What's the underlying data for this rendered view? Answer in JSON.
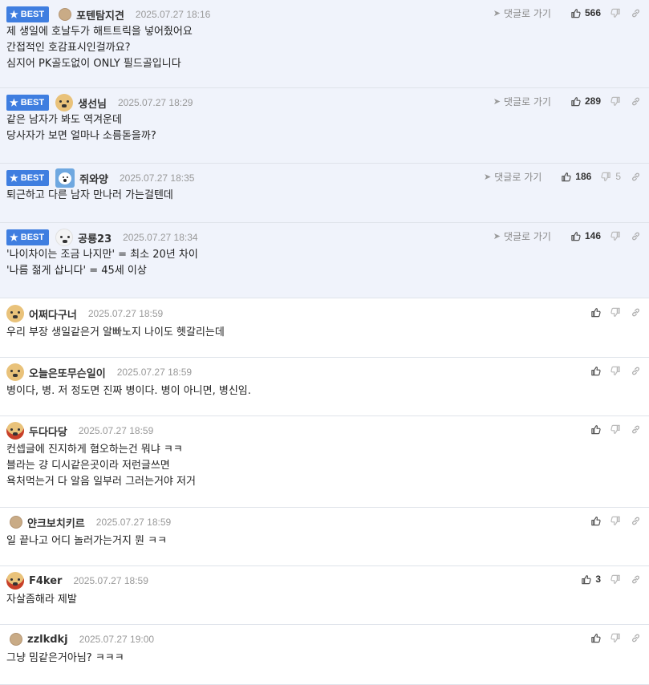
{
  "labels": {
    "best": "BEST",
    "reply": "댓글로 가기"
  },
  "colors": {
    "best_bg": "#f0f3fb",
    "badge": "#3f7ee0",
    "border": "#dfe3ea"
  },
  "comments": [
    {
      "best": true,
      "avatar": "dot",
      "nick": "포텐탐지견",
      "date": "2025.07.27 18:16",
      "lines": [
        "제 생일에 호날두가 해트트릭을 넣어줬어요",
        "간접적인 호감표시인걸까요?",
        "심지어 PK골도없이 ONLY 필드골입니다"
      ],
      "up": "566",
      "down": ""
    },
    {
      "best": true,
      "avatar": "dog",
      "nick": "생선님",
      "date": "2025.07.27 18:29",
      "lines": [
        "같은 남자가 봐도 역겨운데",
        "당사자가 보면 얼마나 소름돋을까?"
      ],
      "up": "289",
      "down": ""
    },
    {
      "best": true,
      "avatar": "bear",
      "nick": "쥐와양",
      "date": "2025.07.27 18:35",
      "lines": [
        "퇴근하고 다른 남자 만나러 가는걸텐데"
      ],
      "up": "186",
      "down": "5"
    },
    {
      "best": true,
      "avatar": "white-dog",
      "nick": "공룡23",
      "date": "2025.07.27 18:34",
      "lines": [
        "'나이차이는 조금 나지만' = 최소 20년 차이",
        "'나름 젊게 삽니다' = 45세 이상"
      ],
      "up": "146",
      "down": ""
    },
    {
      "best": false,
      "avatar": "dog",
      "nick": "어쩌다구너",
      "date": "2025.07.27 18:59",
      "lines": [
        "우리 부장 생일같은거 알빠노지 나이도 헷갈리는데"
      ],
      "up": "",
      "down": ""
    },
    {
      "best": false,
      "avatar": "dog",
      "nick": "오늘은또무슨일이",
      "date": "2025.07.27 18:59",
      "lines": [
        "병이다, 병. 저 정도면 진짜 병이다. 병이 아니면, 병신임."
      ],
      "up": "",
      "down": ""
    },
    {
      "best": false,
      "avatar": "red-dog",
      "nick": "두다다당",
      "date": "2025.07.27 18:59",
      "lines": [
        "컨셉글에 진지하게 혐오하는건 뭐냐 ㅋㅋ",
        "블라는 걍 디시같은곳이라 저런글쓰면",
        "욕처먹는거 다 알음 일부러 그러는거야 저거"
      ],
      "up": "",
      "down": ""
    },
    {
      "best": false,
      "avatar": "dot",
      "nick": "얀크보치키르",
      "date": "2025.07.27 18:59",
      "lines": [
        "일 끝나고 어디 놀러가는거지 뭔 ㅋㅋ"
      ],
      "up": "",
      "down": ""
    },
    {
      "best": false,
      "avatar": "red-dog",
      "nick": "F4ker",
      "date": "2025.07.27 18:59",
      "lines": [
        "자살좀해라 제발"
      ],
      "up": "3",
      "down": ""
    },
    {
      "best": false,
      "avatar": "dot",
      "nick": "zzlkdkj",
      "date": "2025.07.27 19:00",
      "lines": [
        "그냥 밈같은거아님? ㅋㅋㅋ"
      ],
      "up": "",
      "down": ""
    }
  ]
}
